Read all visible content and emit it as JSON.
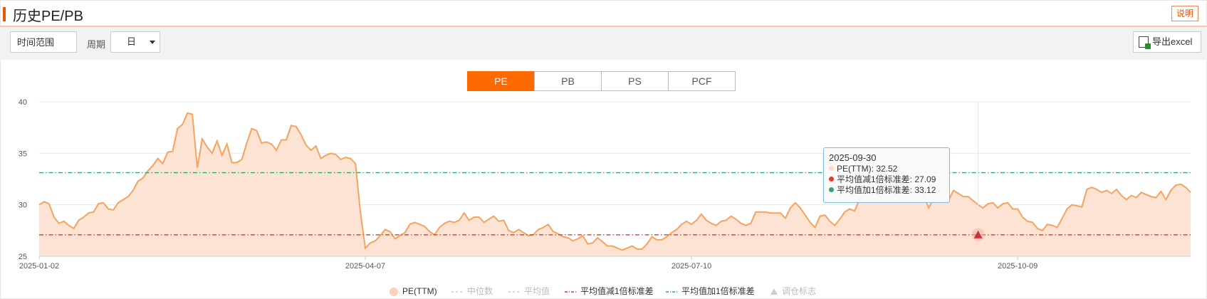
{
  "header": {
    "title": "历史PE/PB",
    "help_label": "说明"
  },
  "toolbar": {
    "range_label": "时间范围",
    "period_label": "周期",
    "period_value": "日",
    "export_label": "导出excel"
  },
  "tabs": [
    {
      "label": "PE",
      "active": true
    },
    {
      "label": "PB",
      "active": false
    },
    {
      "label": "PS",
      "active": false
    },
    {
      "label": "PCF",
      "active": false
    }
  ],
  "tooltip": {
    "date": "2025-09-30",
    "rows": [
      {
        "label": "PE(TTM): 32.52",
        "color": "#ffd9c2"
      },
      {
        "label": "平均值减1倍标准差: 27.09",
        "color": "#e03a2f"
      },
      {
        "label": "平均值加1倍标准差: 33.12",
        "color": "#2aa876"
      }
    ]
  },
  "legend": [
    {
      "label": "PE(TTM)",
      "marker": "circle",
      "color": "#f9d1bd",
      "active": true
    },
    {
      "label": "中位数",
      "marker": "dash",
      "color": "#cccccc",
      "active": false
    },
    {
      "label": "平均值",
      "marker": "dash",
      "color": "#cccccc",
      "active": false
    },
    {
      "label": "平均值减1倍标准差",
      "marker": "dashdot",
      "color": "#e03a2f",
      "active": true
    },
    {
      "label": "平均值加1倍标准差",
      "marker": "dashdot",
      "color": "#2aa876",
      "active": true
    },
    {
      "label": "调仓标志",
      "marker": "triangle",
      "color": "#cccccc",
      "active": false
    }
  ],
  "chart_data": {
    "type": "area",
    "y_ticks": [
      25,
      30,
      35,
      40
    ],
    "ylim": [
      25,
      40
    ],
    "x_ticks": [
      "2025-01-02",
      "2025-04-07",
      "2025-07-10",
      "2025-10-09"
    ],
    "series": [
      {
        "name": "PE(TTM)",
        "color": "#f4a460",
        "fill": "#fde3d3",
        "values": [
          30.0,
          30.3,
          30.1,
          28.8,
          28.2,
          28.4,
          28.0,
          27.7,
          28.5,
          28.8,
          29.2,
          29.3,
          30.1,
          30.2,
          29.6,
          29.5,
          30.2,
          30.5,
          30.8,
          31.4,
          32.3,
          32.6,
          33.3,
          33.8,
          34.5,
          34.0,
          35.1,
          35.2,
          37.4,
          37.8,
          38.9,
          38.8,
          33.6,
          36.4,
          35.6,
          35.0,
          36.2,
          34.8,
          35.9,
          34.1,
          34.1,
          34.4,
          36.0,
          37.4,
          37.2,
          36.0,
          36.1,
          35.9,
          35.3,
          36.3,
          36.3,
          37.7,
          37.6,
          36.8,
          35.8,
          35.3,
          35.7,
          34.5,
          34.8,
          35.0,
          34.9,
          34.4,
          34.6,
          34.5,
          34.0,
          29.3,
          25.8,
          26.3,
          26.5,
          27.0,
          27.6,
          27.4,
          26.7,
          27.0,
          27.3,
          28.1,
          28.3,
          28.1,
          27.9,
          27.4,
          27.1,
          27.8,
          28.2,
          28.4,
          28.3,
          28.5,
          29.2,
          28.5,
          28.8,
          28.8,
          28.3,
          28.6,
          28.9,
          28.4,
          28.5,
          27.5,
          27.3,
          27.6,
          27.3,
          27.0,
          27.1,
          27.6,
          27.8,
          28.1,
          27.4,
          27.2,
          26.9,
          26.8,
          26.5,
          26.7,
          27.0,
          26.2,
          26.3,
          26.8,
          26.4,
          26.0,
          26.0,
          25.8,
          25.6,
          25.8,
          26.0,
          25.7,
          25.7,
          26.2,
          26.9,
          26.6,
          26.6,
          26.9,
          27.3,
          27.6,
          28.1,
          28.4,
          28.1,
          28.5,
          29.1,
          28.5,
          28.2,
          28.0,
          28.4,
          28.5,
          28.9,
          28.6,
          28.2,
          28.0,
          28.2,
          29.3,
          29.3,
          29.3,
          29.2,
          29.2,
          29.2,
          28.7,
          29.7,
          30.2,
          29.7,
          29.0,
          28.3,
          27.8,
          28.9,
          29.0,
          28.4,
          28.0,
          28.6,
          29.3,
          29.6,
          29.4,
          30.5,
          31.0,
          30.8,
          31.2,
          31.7,
          31.9,
          32.3,
          32.5,
          32.5,
          31.5,
          31.0,
          30.7,
          31.3,
          30.9,
          29.7,
          30.6,
          30.9,
          30.5,
          30.4,
          31.4,
          31.1,
          30.8,
          30.8,
          30.4,
          30.0,
          29.7,
          30.1,
          30.2,
          29.7,
          30.1,
          30.2,
          29.6,
          29.6,
          28.8,
          28.4,
          28.3,
          27.7,
          27.5,
          28.1,
          28.0,
          27.8,
          28.7,
          29.6,
          30.0,
          29.9,
          29.8,
          31.5,
          31.7,
          31.5,
          31.2,
          31.4,
          31.1,
          31.5,
          30.9,
          30.5,
          30.9,
          30.7,
          31.2,
          31.0,
          30.8,
          30.7,
          31.3,
          30.5,
          31.4,
          31.9,
          32.0,
          31.7,
          31.2
        ]
      },
      {
        "name": "平均值减1倍标准差",
        "color": "#e03a2f",
        "value": 27.09
      },
      {
        "name": "平均值加1倍标准差",
        "color": "#2aa876",
        "value": 33.12
      }
    ],
    "markers": [
      {
        "type": "triangle",
        "date": "2025-09-30",
        "value": 27.09
      }
    ],
    "legend_position": "bottom",
    "grid": true
  }
}
